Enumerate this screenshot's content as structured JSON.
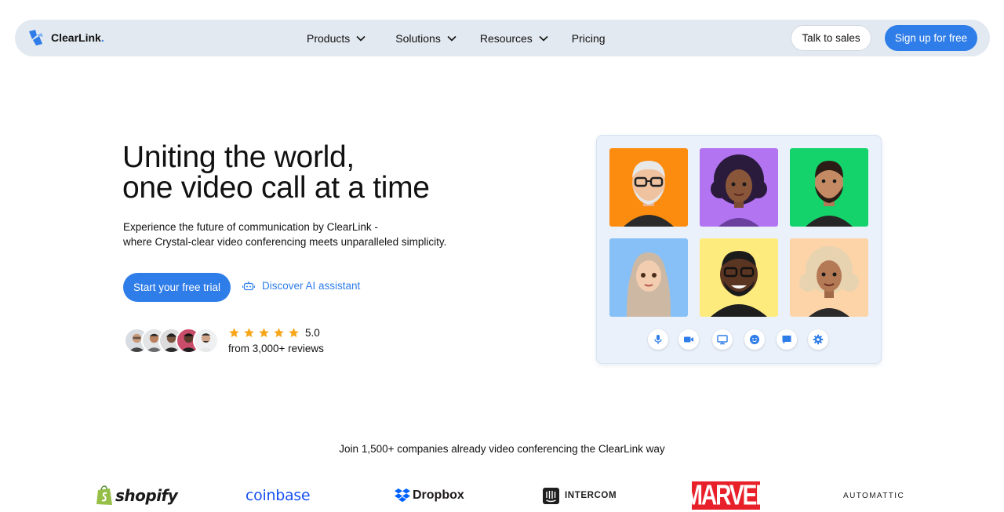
{
  "brand": {
    "name": "ClearLink",
    "dot": ".",
    "accent": "#2f7de8"
  },
  "nav": {
    "items": [
      {
        "label": "Products",
        "has_dropdown": true
      },
      {
        "label": "Solutions",
        "has_dropdown": true
      },
      {
        "label": "Resources",
        "has_dropdown": true
      },
      {
        "label": "Pricing",
        "has_dropdown": false
      }
    ],
    "talk_to_sales": "Talk to sales",
    "sign_up": "Sign up for free"
  },
  "hero": {
    "title_line1": "Uniting the world,",
    "title_line2": "one video call at a time",
    "subtitle_line1": "Experience the future of communication by ClearLink -",
    "subtitle_line2": "where Crystal-clear video conferencing meets unparalleled simplicity.",
    "cta_primary": "Start your free trial",
    "cta_secondary": "Discover AI assistant",
    "rating_value": "5.0",
    "rating_stars": 5,
    "reviews_text": "from 3,000+ reviews"
  },
  "video_panel": {
    "tiles": [
      {
        "name": "older-man-glasses",
        "bg": "#fb8c0f"
      },
      {
        "name": "woman-curly-hair",
        "bg": "#b274f1"
      },
      {
        "name": "bearded-man",
        "bg": "#13d36a"
      },
      {
        "name": "woman-hijab",
        "bg": "#86c0f7"
      },
      {
        "name": "man-glasses-smiling",
        "bg": "#fdeb7e"
      },
      {
        "name": "woman-blonde-curls",
        "bg": "#fdd4a8"
      }
    ],
    "controls": [
      "microphone-icon",
      "video-camera-icon",
      "screen-share-icon",
      "emoji-icon",
      "chat-icon",
      "settings-icon"
    ]
  },
  "companies": {
    "heading": "Join 1,500+ companies already video conferencing the ClearLink way",
    "logos": [
      "shopify",
      "coinbase",
      "Dropbox",
      "INTERCOM",
      "MARVEL",
      "AUTOMATTIC"
    ]
  }
}
